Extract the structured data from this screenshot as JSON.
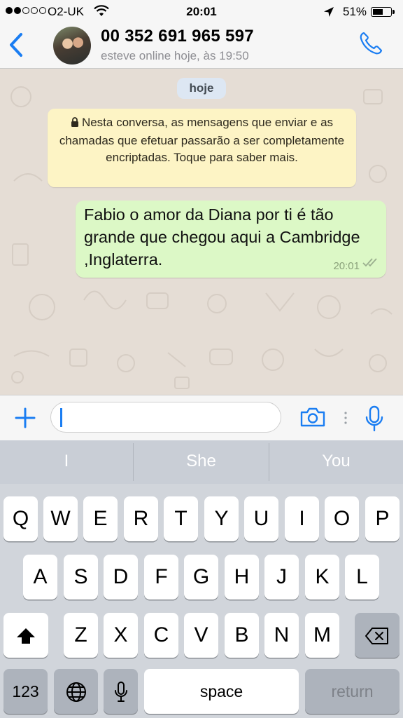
{
  "status_bar": {
    "signal_bars_filled": 2,
    "signal_bars_total": 5,
    "carrier": "O2-UK",
    "time": "20:01",
    "battery": "51%",
    "battery_level": 0.51
  },
  "header": {
    "back_icon": "chevron-left-icon",
    "contact_name": "00 352 691 965 597",
    "last_seen": "esteve online hoje, às 19:50",
    "call_icon": "phone-icon",
    "accent_color": "#1a7df2"
  },
  "chat": {
    "date_label": "hoje",
    "encryption_notice": "Nesta conversa, as mensagens que enviar e as chamadas que efetuar passarão a ser completamente encriptadas. Toque para saber mais.",
    "messages": [
      {
        "direction": "outgoing",
        "text": "Fabio o amor da Diana por ti é tão grande que chegou aqui a Cambridge ,Inglaterra.",
        "time": "20:01",
        "status": "delivered"
      }
    ]
  },
  "composer": {
    "input_value": "",
    "attach_icon": "plus-icon",
    "camera_icon": "camera-icon",
    "mic_icon": "microphone-icon"
  },
  "keyboard": {
    "predictions": [
      "I",
      "She",
      "You"
    ],
    "row1": [
      "Q",
      "W",
      "E",
      "R",
      "T",
      "Y",
      "U",
      "I",
      "O",
      "P"
    ],
    "row2": [
      "A",
      "S",
      "D",
      "F",
      "G",
      "H",
      "J",
      "K",
      "L"
    ],
    "row3": [
      "Z",
      "X",
      "C",
      "V",
      "B",
      "N",
      "M"
    ],
    "numbers_key": "123",
    "space_key": "space",
    "return_key": "return"
  }
}
